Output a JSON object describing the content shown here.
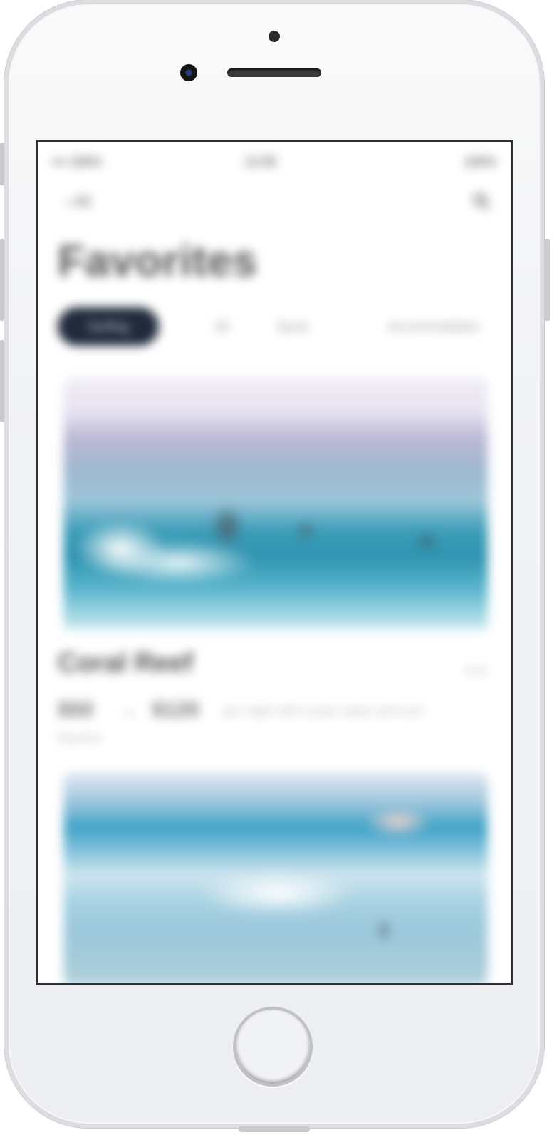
{
  "status_bar": {
    "left": "••• 100%",
    "center": "12:00",
    "right": "100%"
  },
  "nav": {
    "back_label": "‹ All",
    "search_icon": "search-icon"
  },
  "page": {
    "title": "Favorites"
  },
  "tabs": [
    {
      "label": "Surfing",
      "active": true
    },
    {
      "label": "All",
      "active": false
    },
    {
      "label": "Spots",
      "active": false
    },
    {
      "label": "Accommodation",
      "active": false
    }
  ],
  "cards": [
    {
      "title": "Coral Reef",
      "meta": "4 km",
      "price_from": "$50",
      "price_sep": "–",
      "price_to": "$120",
      "description": "per night with ocean views and surf",
      "description_2": "lessons"
    }
  ]
}
